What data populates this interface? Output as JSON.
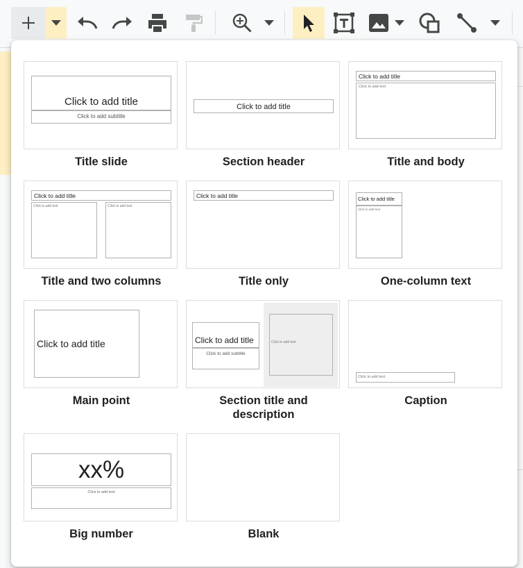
{
  "toolbar": {
    "icons": [
      "plus-icon",
      "caret-down-icon",
      "undo-icon",
      "redo-icon",
      "print-icon",
      "paint-format-icon",
      "zoom-icon",
      "caret-down-icon",
      "select-cursor-icon",
      "text-box-icon",
      "image-icon",
      "caret-down-icon",
      "shape-icon",
      "line-icon",
      "caret-down-icon"
    ]
  },
  "colors": {
    "active": "#feefc3",
    "border": "#dadce0",
    "icon": "#444746",
    "disabled_icon": "#c4c7c5"
  },
  "layouts": {
    "title_slide": {
      "label": "Title slide",
      "title": "Click to add title",
      "subtitle": "Click to add subtitle"
    },
    "section_header": {
      "label": "Section header",
      "title": "Click to add title"
    },
    "title_body": {
      "label": "Title and body",
      "title": "Click to add title",
      "text": "Click to add text"
    },
    "two_columns": {
      "label": "Title and two columns",
      "title": "Click to add title",
      "text_left": "Click to add text",
      "text_right": "Click to add text"
    },
    "title_only": {
      "label": "Title only",
      "title": "Click to add title"
    },
    "one_column": {
      "label": "One-column text",
      "title": "Click to add title",
      "text": "Click to add text"
    },
    "main_point": {
      "label": "Main point",
      "title": "Click to add title"
    },
    "section_desc": {
      "label_line1": "Section title and",
      "label_line2": "description",
      "title": "Click to add title",
      "subtitle": "Click to add subtitle",
      "text": "Click to add text"
    },
    "caption": {
      "label": "Caption",
      "text": "Click to add text"
    },
    "big_number": {
      "label": "Big number",
      "number": "xx%",
      "text": "Click to add text"
    },
    "blank": {
      "label": "Blank"
    }
  }
}
